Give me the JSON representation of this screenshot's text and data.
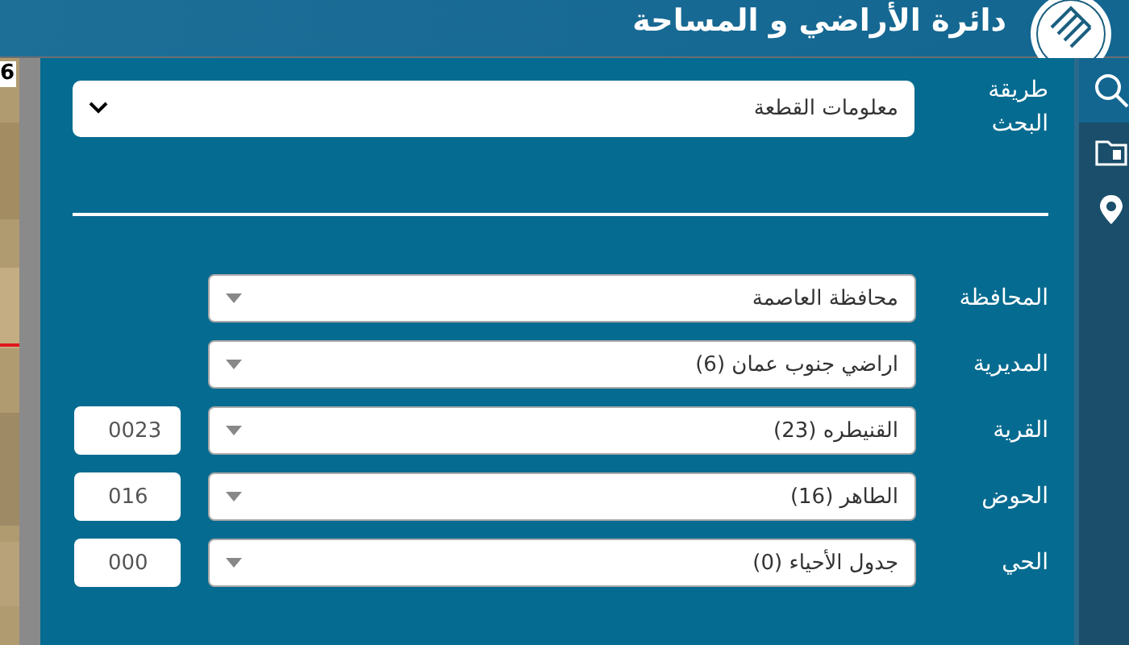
{
  "header": {
    "title": "دائرة الأراضي و المساحة"
  },
  "map": {
    "kind": "picture",
    "label": "6"
  },
  "sidebar": {
    "items": [
      {
        "kind": "search",
        "selected": true
      },
      {
        "kind": "folder",
        "selected": false
      },
      {
        "kind": "pin",
        "selected": false
      }
    ]
  },
  "search_method": {
    "label": "طريقة البحث",
    "value": "معلومات القطعة"
  },
  "fields": [
    {
      "label": "المحافظة",
      "value": "محافظة العاصمة"
    },
    {
      "label": "المديرية",
      "value": "اراضي جنوب عمان (6)"
    },
    {
      "label": "القرية",
      "value": "القنيطره (23)",
      "code": "0023"
    },
    {
      "label": "الحوض",
      "value": "الطاهر (16)",
      "code": "016"
    },
    {
      "label": "الحي",
      "value": "جدول الأحياء (0)",
      "code": "000"
    }
  ]
}
